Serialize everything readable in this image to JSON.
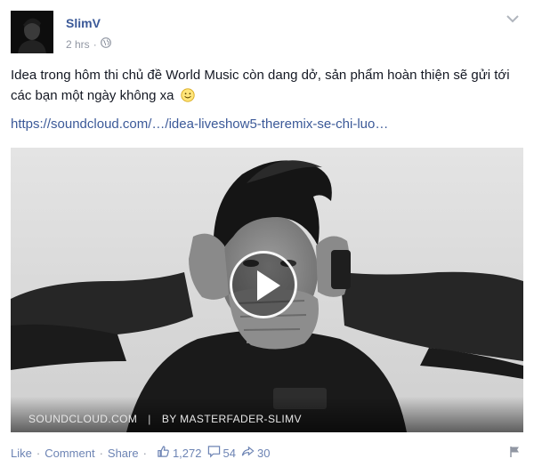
{
  "post": {
    "author": "SlimV",
    "time": "2 hrs",
    "privacy_icon": "globe-icon",
    "text": "Idea trong hôm thi chủ đề World Music còn dang dở, sản phẩm hoàn thiện sẽ gửi tới các bạn một ngày không xa",
    "emoji": "🙂",
    "link": "https://soundcloud.com/…/idea-liveshow5-theremix-se-chi-luo…"
  },
  "media": {
    "source": "SOUNDCLOUD.COM",
    "separator": "|",
    "byline": "BY MASTERFADER-SLIMV"
  },
  "actions": {
    "like": "Like",
    "comment": "Comment",
    "share": "Share",
    "dot": "·",
    "likes_count": "1,272",
    "comments_count": "54",
    "shares_count": "30"
  },
  "colors": {
    "link_blue": "#3b5998",
    "action_blue": "#6d84b4",
    "meta_gray": "#9197a3"
  }
}
